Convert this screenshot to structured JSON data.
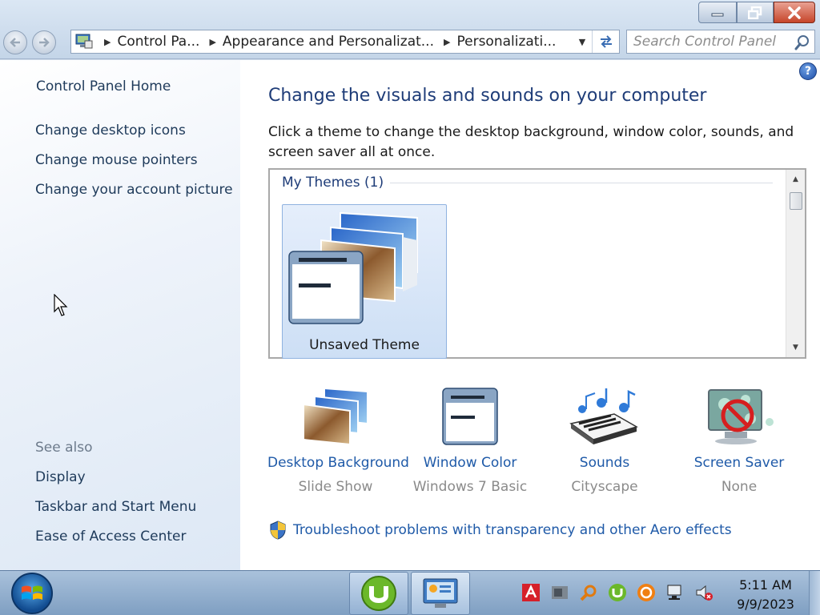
{
  "window": {
    "buttons": {
      "minimize": "minimize",
      "restore": "restore",
      "close": "close"
    }
  },
  "address": {
    "crumbs": [
      "Control Pa...",
      "Appearance and Personalizat...",
      "Personalizati..."
    ]
  },
  "search": {
    "placeholder": "Search Control Panel"
  },
  "sidebar": {
    "home": "Control Panel Home",
    "links": [
      "Change desktop icons",
      "Change mouse pointers",
      "Change your account picture"
    ],
    "see_also": "See also",
    "see_also_links": [
      "Display",
      "Taskbar and Start Menu",
      "Ease of Access Center"
    ]
  },
  "main": {
    "title": "Change the visuals and sounds on your computer",
    "description": "Click a theme to change the desktop background, window color, sounds, and screen saver all at once.",
    "group": "My Themes (1)",
    "themes": [
      {
        "name": "Unsaved Theme"
      }
    ],
    "options": [
      {
        "label": "Desktop Background",
        "value": "Slide Show",
        "icon": "desktop-background-icon"
      },
      {
        "label": "Window Color",
        "value": "Windows 7 Basic",
        "icon": "window-color-icon"
      },
      {
        "label": "Sounds",
        "value": "Cityscape",
        "icon": "sounds-icon"
      },
      {
        "label": "Screen Saver",
        "value": "None",
        "icon": "screen-saver-icon"
      }
    ],
    "troubleshoot": "Troubleshoot problems with transparency and other Aero effects"
  },
  "taskbar": {
    "clock_time": "5:11 AM",
    "clock_date": "9/9/2023"
  },
  "colors": {
    "link": "#1f5aa8",
    "title": "#1e3c78",
    "close_button": "#c6452a"
  }
}
